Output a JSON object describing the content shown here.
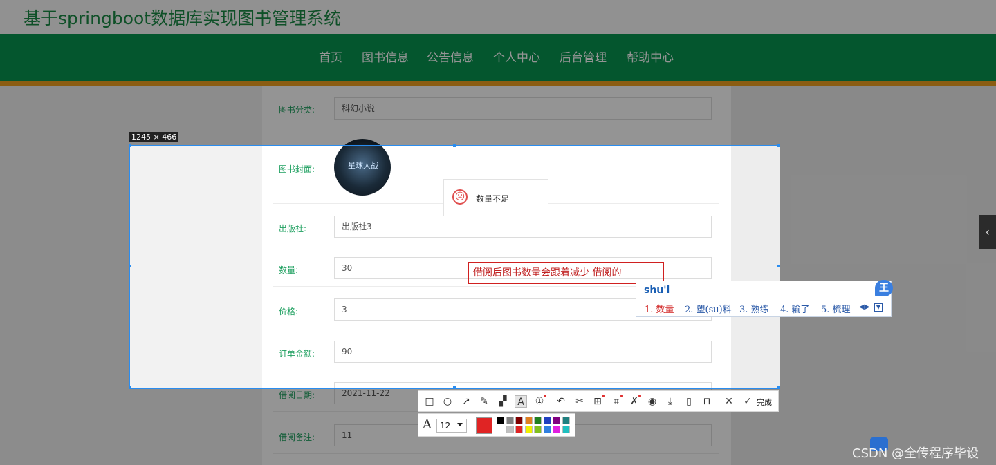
{
  "site": {
    "title": "基于springboot数据库实现图书管理系统"
  },
  "nav": {
    "items": [
      "首页",
      "图书信息",
      "公告信息",
      "个人中心",
      "后台管理",
      "帮助中心"
    ]
  },
  "form": {
    "category": {
      "label": "图书分类:",
      "value": "科幻小说"
    },
    "cover": {
      "label": "图书封面:",
      "image_text": "星球大战"
    },
    "publisher": {
      "label": "出版社:",
      "value": "出版社3"
    },
    "quantity": {
      "label": "数量:",
      "value": "30"
    },
    "price": {
      "label": "价格:",
      "value": "3"
    },
    "order_amount": {
      "label": "订单金额:",
      "value": "90"
    },
    "borrow_date": {
      "label": "借阅日期:",
      "value": "2021-11-22"
    },
    "borrow_note": {
      "label": "借阅备注:",
      "value": "11"
    }
  },
  "toast": {
    "icon": "frown-icon",
    "message": "数量不足"
  },
  "screenshot_tool": {
    "size_label": "1245 × 466",
    "annotation_text": "借阅后图书数量会跟着减少  借阅的",
    "done_label": "完成",
    "font_size": "12",
    "current_color": "#e02424",
    "palette": [
      "#000000",
      "#808080",
      "#800000",
      "#e08020",
      "#208020",
      "#2040c0",
      "#800080",
      "#208080",
      "#ffffff",
      "#c0c0c0",
      "#e02424",
      "#f0f000",
      "#80c020",
      "#3080e0",
      "#e020e0",
      "#20c0c0"
    ]
  },
  "ime": {
    "input": "shu'l",
    "badge": "王",
    "candidates": [
      "1. 数量",
      "2. 塑(su)料",
      "3. 熟练",
      "4. 输了",
      "5. 梳理"
    ]
  },
  "watermark": "CSDN @全传程序毕设",
  "side_tab_icon": "chevron-left-icon"
}
